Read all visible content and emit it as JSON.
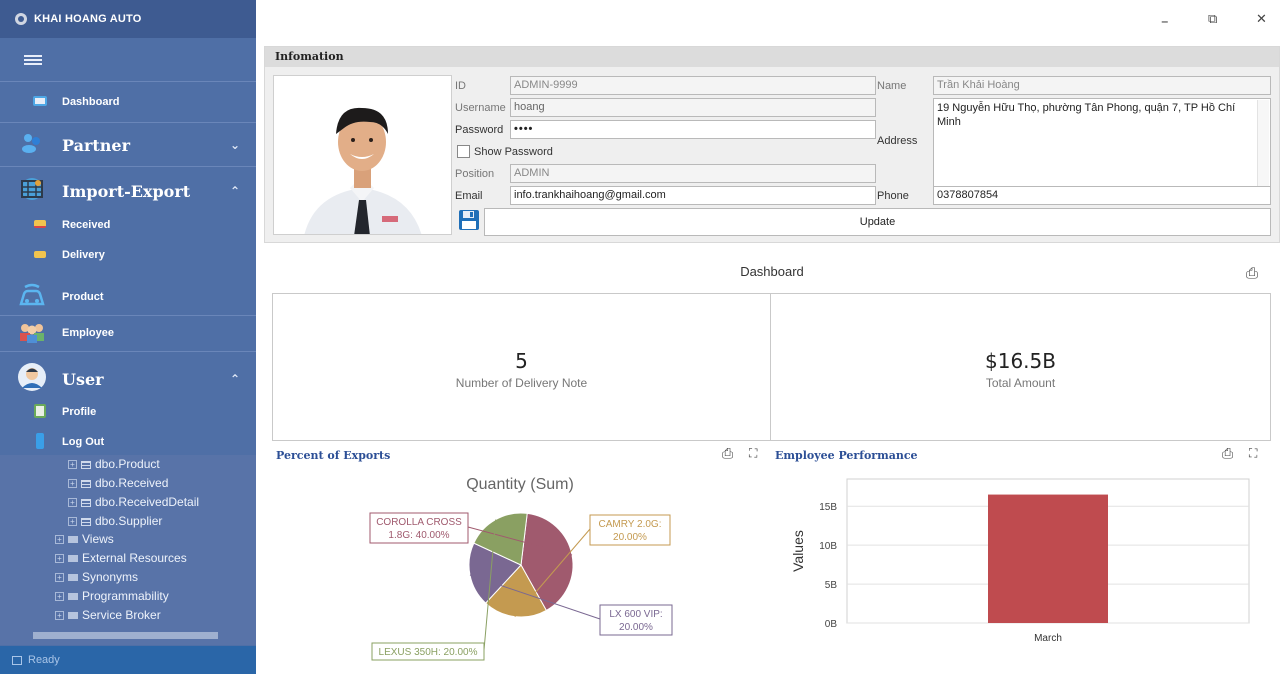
{
  "app": {
    "name": "KHAI HOANG AUTO",
    "status_text": "Ready"
  },
  "sidebar": {
    "dashboard": "Dashboard",
    "partner": "Partner",
    "import_export": "Import-Export",
    "received": "Received",
    "delivery": "Delivery",
    "product": "Product",
    "employee": "Employee",
    "user": "User",
    "profile": "Profile",
    "logout": "Log Out",
    "tree": [
      "dbo.Product",
      "dbo.Received",
      "dbo.ReceivedDetail",
      "dbo.Supplier",
      "Views",
      "External Resources",
      "Synonyms",
      "Programmability",
      "Service Broker"
    ]
  },
  "window": {
    "minimize": "–",
    "maximize": "⧉",
    "close": "✕"
  },
  "info": {
    "header": "Infomation",
    "id_label": "ID",
    "id_value": "ADMIN-9999",
    "username_label": "Username",
    "username_value": "hoang",
    "password_label": "Password",
    "password_value": "••••",
    "show_password": "Show Password",
    "position_label": "Position",
    "position_value": "ADMIN",
    "email_label": "Email",
    "email_value": "info.trankhaihoang@gmail.com",
    "name_label": "Name",
    "name_value": "Trần Khải Hoàng",
    "address_label": "Address",
    "address_value": "19 Nguyễn Hữu Thọ, phường Tân Phong, quận 7, TP Hồ Chí Minh",
    "phone_label": "Phone",
    "phone_value": "0378807854",
    "update": "Update"
  },
  "dashboard": {
    "title": "Dashboard",
    "card1_value": "5",
    "card1_caption": "Number of Delivery Note",
    "card2_value": "$16.5B",
    "card2_caption": "Total Amount"
  },
  "panels": {
    "exports_title": "Percent of Exports",
    "performance_title": "Employee Performance"
  },
  "chart_data": [
    {
      "type": "pie",
      "title": "Quantity (Sum)",
      "slices": [
        {
          "label": "COROLLA CROSS 1.8G: 40.00%",
          "name": "COROLLA CROSS 1.8G",
          "value": 40.0,
          "color": "#a05a6e"
        },
        {
          "label": "CAMRY 2.0G: 20.00%",
          "name": "CAMRY 2.0G",
          "value": 20.0,
          "color": "#c49a50"
        },
        {
          "label": "LX 600 VIP: 20.00%",
          "name": "LX 600 VIP",
          "value": 20.0,
          "color": "#7a6892"
        },
        {
          "label": "LEXUS 350H: 20.00%",
          "name": "LEXUS 350H",
          "value": 20.0,
          "color": "#8aa062"
        }
      ]
    },
    {
      "type": "bar",
      "categories": [
        "March"
      ],
      "values": [
        16.5
      ],
      "ylabel": "Values",
      "yticks": [
        "0B",
        "5B",
        "10B",
        "15B"
      ],
      "ylim": [
        0,
        18.5
      ],
      "color": "#bf4b4f"
    }
  ]
}
